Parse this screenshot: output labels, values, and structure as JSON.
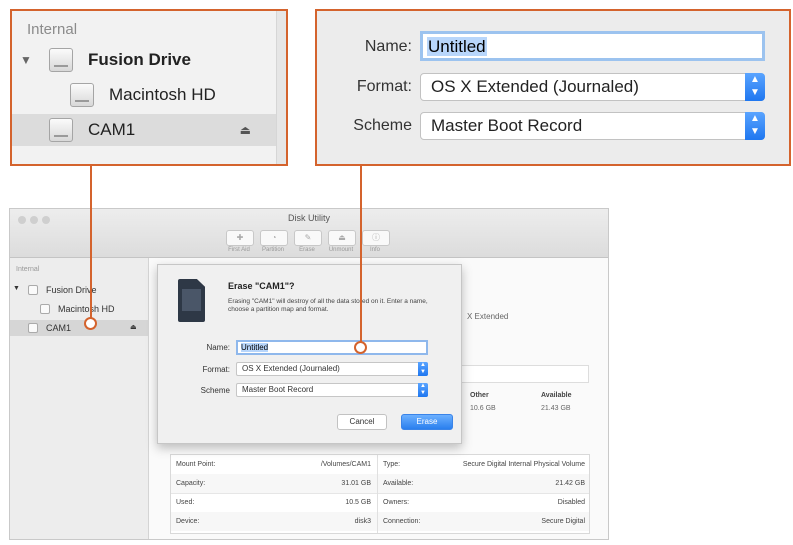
{
  "sidebar_zoom": {
    "section_header": "Internal",
    "items": [
      {
        "label": "Fusion Drive",
        "expanded": true
      },
      {
        "label": "Macintosh HD"
      },
      {
        "label": "CAM1",
        "selected": true,
        "eject": "⏏"
      }
    ]
  },
  "form_zoom": {
    "name_label": "Name:",
    "name_value": "Untitled",
    "format_label": "Format:",
    "format_value": "OS X Extended (Journaled)",
    "scheme_label": "Scheme",
    "scheme_value": "Master Boot Record"
  },
  "window": {
    "title": "Disk Utility",
    "toolbar": [
      "First Aid",
      "Partition",
      "Erase",
      "Unmount",
      "Info"
    ],
    "sidebar": {
      "section_header": "Internal",
      "items": [
        {
          "label": "Fusion Drive"
        },
        {
          "label": "Macintosh HD"
        },
        {
          "label": "CAM1",
          "eject": "⏏"
        }
      ]
    },
    "background": {
      "format_fragment": "X Extended",
      "other_label": "Other",
      "other_value": "10.6 GB",
      "available_label": "Available",
      "available_value": "21.43 GB"
    },
    "info_table": {
      "rows": [
        {
          "k1": "Mount Point:",
          "v1": "/Volumes/CAM1",
          "k2": "Type:",
          "v2": "Secure Digital Internal Physical Volume"
        },
        {
          "k1": "Capacity:",
          "v1": "31.01 GB",
          "k2": "Available:",
          "v2": "21.42 GB"
        },
        {
          "k1": "Used:",
          "v1": "10.5 GB",
          "k2": "Owners:",
          "v2": "Disabled"
        },
        {
          "k1": "Device:",
          "v1": "disk3",
          "k2": "Connection:",
          "v2": "Secure Digital"
        }
      ]
    }
  },
  "sheet": {
    "title": "Erase \"CAM1\"?",
    "description": "Erasing \"CAM1\" will destroy of all the data stored on it. Enter a name, choose a partition map and format.",
    "name_label": "Name:",
    "name_value": "Untitled",
    "format_label": "Format:",
    "format_value": "OS X Extended (Journaled)",
    "scheme_label": "Scheme",
    "scheme_value": "Master Boot Record",
    "cancel_label": "Cancel",
    "erase_label": "Erase"
  },
  "colors": {
    "callout": "#d4632d",
    "accent": "#2a7fee"
  }
}
